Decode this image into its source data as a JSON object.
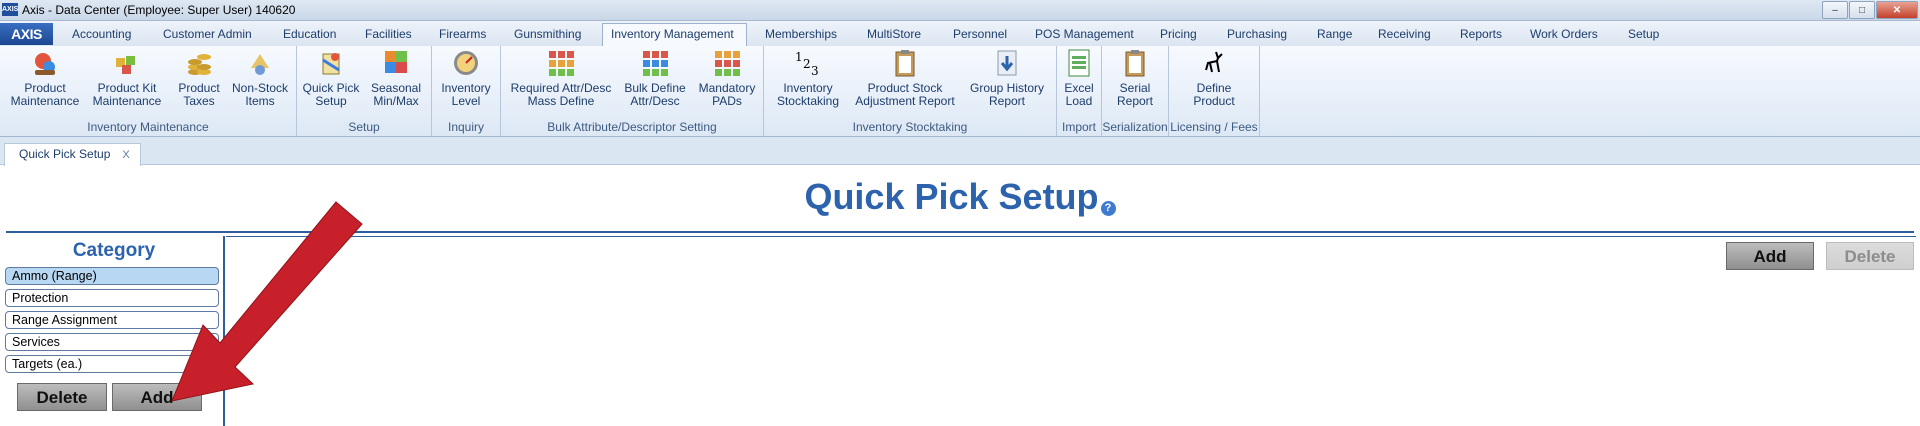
{
  "window": {
    "title": "Axis - Data Center  (Employee: Super User) 140620",
    "app_icon": "AXIS"
  },
  "menu": {
    "logo": "AXIS",
    "tabs": [
      "Accounting",
      "Customer Admin",
      "Education",
      "Facilities",
      "Firearms",
      "Gunsmithing",
      "Inventory Management",
      "Memberships",
      "MultiStore",
      "Personnel",
      "POS Management",
      "Pricing",
      "Purchasing",
      "Range",
      "Receiving",
      "Reports",
      "Work Orders",
      "Setup"
    ],
    "active_tab": "Inventory Management"
  },
  "ribbon": {
    "groups": [
      {
        "caption": "Inventory Maintenance",
        "buttons": [
          {
            "label": "Product\nMaintenance",
            "icon": "product-maintenance-icon"
          },
          {
            "label": "Product Kit\nMaintenance",
            "icon": "product-kit-icon"
          },
          {
            "label": "Product\nTaxes",
            "icon": "coins-icon"
          },
          {
            "label": "Non-Stock\nItems",
            "icon": "non-stock-icon"
          }
        ]
      },
      {
        "caption": "Setup",
        "buttons": [
          {
            "label": "Quick Pick\nSetup",
            "icon": "quick-pick-icon"
          },
          {
            "label": "Seasonal\nMin/Max",
            "icon": "seasonal-icon"
          }
        ]
      },
      {
        "caption": "Inquiry",
        "buttons": [
          {
            "label": "Inventory\nLevel",
            "icon": "gauge-icon"
          }
        ]
      },
      {
        "caption": "Bulk Attribute/Descriptor Setting",
        "buttons": [
          {
            "label": "Required Attr/Desc\nMass Define",
            "icon": "grid-icon"
          },
          {
            "label": "Bulk Define\nAttr/Desc",
            "icon": "grid-icon"
          },
          {
            "label": "Mandatory\nPADs",
            "icon": "grid-icon"
          }
        ]
      },
      {
        "caption": "Inventory Stocktaking",
        "buttons": [
          {
            "label": "Inventory\nStocktaking",
            "icon": "numbers-icon"
          },
          {
            "label": "Product Stock\nAdjustment Report",
            "icon": "clipboard-icon"
          },
          {
            "label": "Group History\nReport",
            "icon": "download-icon"
          }
        ]
      },
      {
        "caption": "Import",
        "buttons": [
          {
            "label": "Excel\nLoad",
            "icon": "excel-icon"
          }
        ]
      },
      {
        "caption": "Serialization",
        "buttons": [
          {
            "label": "Serial\nReport",
            "icon": "clipboard-icon"
          }
        ]
      },
      {
        "caption": "Licensing / Fees",
        "buttons": [
          {
            "label": "Define\nProduct",
            "icon": "deer-icon"
          }
        ]
      }
    ]
  },
  "doc_tab": {
    "label": "Quick Pick Setup",
    "close": "X"
  },
  "page": {
    "title": "Quick Pick Setup",
    "help": "?",
    "category_header": "Category",
    "categories": [
      "Ammo (Range)",
      "Protection",
      "Range Assignment",
      "Services",
      "Targets (ea.)"
    ],
    "selected_category": "Ammo (Range)",
    "left_delete": "Delete",
    "left_add": "Add",
    "right_add": "Add",
    "right_delete": "Delete"
  },
  "colors": {
    "accent": "#2d63ad",
    "arrow": "#c8202a"
  }
}
